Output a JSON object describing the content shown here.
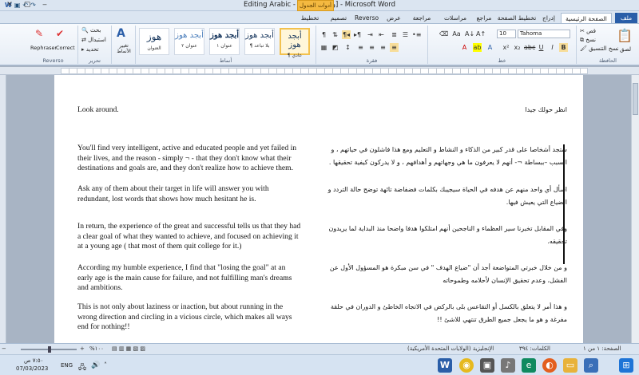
{
  "window": {
    "title": "Editing Arabic - [وضع التوافق] - Microsoft Word",
    "context_tab_title": "أدوات الجدول"
  },
  "tabs": {
    "file": "ملف",
    "home": "الصفحة الرئيسية",
    "insert": "إدراج",
    "page_layout": "تخطيط الصفحة",
    "references": "مراجع",
    "mailings": "مراسلات",
    "review": "مراجعة",
    "view": "عرض",
    "reverso": "Reverso",
    "design": "تصميم",
    "layout": "تخطيط"
  },
  "ribbon": {
    "clipboard": {
      "label": "الحافظة",
      "paste": "لصق",
      "cut": "قص",
      "copy": "نسخ",
      "format_painter": "نسخ التنسيق"
    },
    "font": {
      "label": "خط",
      "font_name": "Tahoma",
      "font_size": "10"
    },
    "paragraph": {
      "label": "فقرة"
    },
    "styles": {
      "label": "أنماط",
      "items": [
        {
          "sample": "أبجد هوز",
          "name": "¶ عادي"
        },
        {
          "sample": "أبجد هوز",
          "name": "¶ بلا تباعد"
        },
        {
          "sample": "أبجد هوز",
          "name": "عنوان ١"
        },
        {
          "sample": "أبجد هوز",
          "name": "عنوان ٢"
        },
        {
          "sample": "هوز",
          "name": "العنوان"
        }
      ],
      "change_styles": "تغيير الأنماط"
    },
    "editing": {
      "label": "تحرير",
      "find": "بحث",
      "replace": "استبدال",
      "select": "تحديد"
    },
    "reverso": {
      "label": "Reverso",
      "rephraser": "Rephraser",
      "correct": "Correct"
    }
  },
  "document": {
    "en": [
      "Look around.",
      "You'll find  very intelligent, active and educated people and yet failed in their lives,  and the reason - simply  ¬ - that they don't know what their destinations and goals are, and they don't realize how to achieve them.",
      "Ask any of them about their target in life will answer you with redundant, lost words that shows how much hesitant he is.",
      "In return, the experience of the great and successful tells us that they had a clear goal  of what they wanted to achieve, and focused on achieving it at a  young age ( that most of them quit college for it.)",
      "According my humble experience, I find that \"losing the goal\" at an early age is the main cause for failure, and not fulfilling man's dreams and ambitions.",
      "This is not only about laziness or inaction, but about running in the wrong direction and circling in a vicious  circle,  which makes all ways end for nothing!!"
    ],
    "ar": [
      "انظر حولك جيدا",
      "ستجد أشخاصا على قدر كبير من الذكاء و النشاط و التعليم ومع هذا فاشلون في حياتهم ، و السبب –ببساطة ¬- أنهم لا يعرفون ما هي وجهاتهم و أهدافهم ، و لا يدركون كيفية تحقيقها .",
      "اسأل أي واحد منهم عن هدفه في الحياة سيجيبك بكلمات فضفاضة تائهة توضح حالة التردد و الضياع التي يعيش فيها.",
      "وفي المقابل تخبرنا سير العظماء و الناجحين أنهم امتلكوا هدفا واضحا منذ البداية لما يريدون تحقيقه.",
      "و من خلال خبرتي المتواضعة أجد أن \"ضياع الهدف \" في سن مبكرة هو المسؤول الأول عن الفشل، وعدم تحقيق الإنسان لأحلامه وطموحاته",
      "و هذا أمر لا يتعلق بالكسل أو التقاعس بلى بالركض في الاتجاه الخاطئ و الدوران في حلقة مفرغة و هو ما يجعل جميع الطرق تنتهي للاشئ !!"
    ]
  },
  "status": {
    "page": "الصفحة: ١ من ١",
    "words": "الكلمات: ٣٩٤",
    "language": "الإنجليزية (الولايات المتحدة الأمريكية)",
    "zoom": "%١٠٠"
  },
  "taskbar": {
    "time": "٧:٥٠ ص",
    "date": "07/03/2023",
    "lang": "ENG"
  },
  "colors": {
    "accent": "#2a5ea8",
    "selected_style": "#f2c14e"
  }
}
